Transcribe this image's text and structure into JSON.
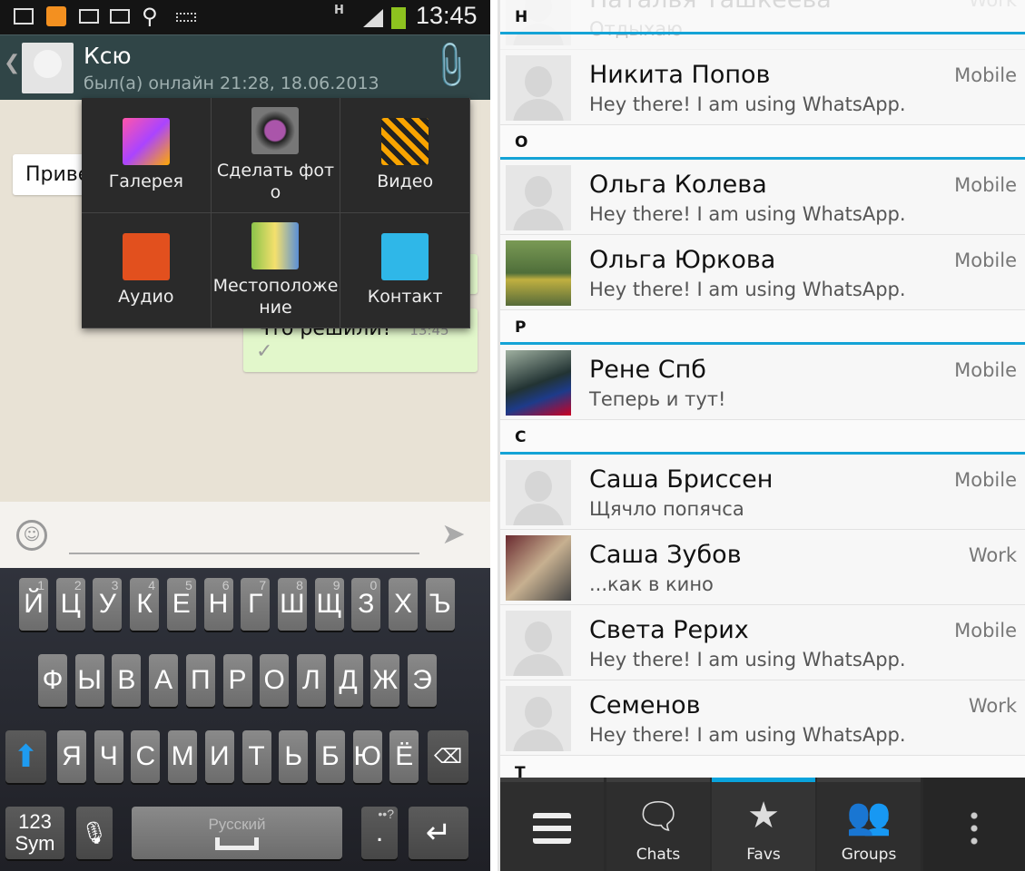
{
  "status_bar": {
    "time": "13:45",
    "network": "H"
  },
  "chat": {
    "contact_name": "Ксю",
    "last_seen": "был(а) онлайн 21:28, 18.06.2013",
    "messages": [
      {
        "text": "Привет",
        "direction": "in"
      },
      {
        "text": "",
        "direction": "out"
      },
      {
        "text": "Что решили?",
        "time": "13:45",
        "direction": "out",
        "status": "✓"
      }
    ],
    "attach_menu": [
      {
        "label": "Галерея",
        "icon": "gallery-icon"
      },
      {
        "label": "Сделать фото",
        "icon": "camera-icon"
      },
      {
        "label": "Видео",
        "icon": "video-icon"
      },
      {
        "label": "Аудио",
        "icon": "audio-icon"
      },
      {
        "label": "Местоположение",
        "icon": "location-icon"
      },
      {
        "label": "Контакт",
        "icon": "contact-icon"
      }
    ],
    "input_value": ""
  },
  "keyboard": {
    "row1": [
      "Й",
      "Ц",
      "У",
      "К",
      "Е",
      "Н",
      "Г",
      "Ш",
      "Щ",
      "З",
      "Х",
      "Ъ"
    ],
    "row1_nums": [
      "1",
      "2",
      "3",
      "4",
      "5",
      "6",
      "7",
      "8",
      "9",
      "0",
      "",
      ""
    ],
    "row2": [
      "Ф",
      "Ы",
      "В",
      "А",
      "П",
      "Р",
      "О",
      "Л",
      "Д",
      "Ж",
      "Э"
    ],
    "row3": [
      "Я",
      "Ч",
      "С",
      "М",
      "И",
      "Т",
      "Ь",
      "Б",
      "Ю",
      "Ё"
    ],
    "sym_label_1": "123",
    "sym_label_2": "Sym",
    "language": "Русский",
    "dot": ".",
    "dot_hint": "••?"
  },
  "contacts": {
    "partial_top": {
      "name": "Наталья Ташкеева",
      "status": "Отдыхаю",
      "type": "Work"
    },
    "sticky_header": "Н",
    "sections": [
      {
        "letter": "Н",
        "rows": [
          {
            "name": "Никита Попов",
            "status": "Hey there! I am using WhatsApp.",
            "type": "Mobile",
            "photo": false
          }
        ]
      },
      {
        "letter": "О",
        "rows": [
          {
            "name": "Ольга Колева",
            "status": "Hey there! I am using WhatsApp.",
            "type": "Mobile",
            "photo": false
          },
          {
            "name": "Ольга Юркова",
            "status": "Hey there! I am using WhatsApp.",
            "type": "Mobile",
            "photo": true
          }
        ]
      },
      {
        "letter": "Р",
        "rows": [
          {
            "name": "Рене Спб",
            "status": "Теперь и тут!",
            "type": "Mobile",
            "photo": true
          }
        ]
      },
      {
        "letter": "С",
        "rows": [
          {
            "name": "Саша Бриссен",
            "status": "Щячло попячса",
            "type": "Mobile",
            "photo": false
          },
          {
            "name": "Саша Зубов",
            "status": "...как в кино",
            "type": "Work",
            "photo": true
          },
          {
            "name": "Света Рерих",
            "status": "Hey there! I am using WhatsApp.",
            "type": "Mobile",
            "photo": false
          },
          {
            "name": "Семенов",
            "status": "Hey there! I am using WhatsApp.",
            "type": "Work",
            "photo": false
          }
        ]
      },
      {
        "letter": "Т",
        "rows": []
      }
    ]
  },
  "bottom_bar": {
    "tabs": [
      {
        "label": "Chats"
      },
      {
        "label": "Favs",
        "selected": true
      },
      {
        "label": "Groups"
      }
    ]
  },
  "colors": {
    "accent": "#14a3d6",
    "header": "#304547",
    "keyboard": "#25272e"
  }
}
